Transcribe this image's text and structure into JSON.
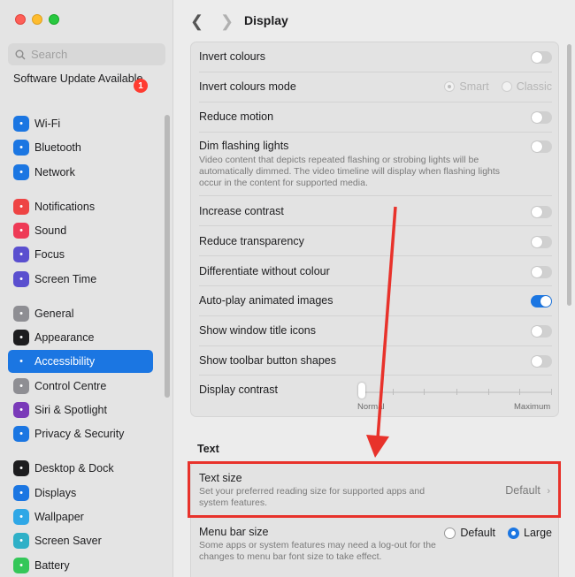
{
  "window": {
    "title": "Display"
  },
  "sidebar": {
    "search_placeholder": "Search",
    "update": {
      "label": "Software Update Available",
      "badge": "1"
    },
    "items": [
      {
        "label": "Wi-Fi",
        "color": "#1b76e2",
        "icon": "wifi-icon"
      },
      {
        "label": "Bluetooth",
        "color": "#1b76e2",
        "icon": "bluetooth-icon"
      },
      {
        "label": "Network",
        "color": "#1b76e2",
        "icon": "globe-icon"
      },
      {
        "label": "Notifications",
        "color": "#ee4444",
        "icon": "bell-icon"
      },
      {
        "label": "Sound",
        "color": "#ee3a56",
        "icon": "speaker-icon"
      },
      {
        "label": "Focus",
        "color": "#5a4fcf",
        "icon": "moon-icon"
      },
      {
        "label": "Screen Time",
        "color": "#5a4fcf",
        "icon": "hourglass-icon"
      },
      {
        "label": "General",
        "color": "#8e8e93",
        "icon": "gear-icon"
      },
      {
        "label": "Appearance",
        "color": "#1d1d1f",
        "icon": "appearance-icon"
      },
      {
        "label": "Accessibility",
        "color": "#1b76e2",
        "icon": "accessibility-icon",
        "selected": true
      },
      {
        "label": "Control Centre",
        "color": "#8e8e93",
        "icon": "control-centre-icon"
      },
      {
        "label": "Siri & Spotlight",
        "color": "#7a3ab9",
        "icon": "siri-icon"
      },
      {
        "label": "Privacy & Security",
        "color": "#1b76e2",
        "icon": "hand-icon"
      },
      {
        "label": "Desktop & Dock",
        "color": "#1d1d1f",
        "icon": "dock-icon"
      },
      {
        "label": "Displays",
        "color": "#1b76e2",
        "icon": "sun-icon"
      },
      {
        "label": "Wallpaper",
        "color": "#2fa7e6",
        "icon": "wallpaper-icon"
      },
      {
        "label": "Screen Saver",
        "color": "#2fb0c7",
        "icon": "screen-saver-icon"
      },
      {
        "label": "Battery",
        "color": "#34c759",
        "icon": "battery-icon"
      }
    ]
  },
  "display": {
    "invert_colours": {
      "label": "Invert colours",
      "on": false
    },
    "invert_mode": {
      "label": "Invert colours mode",
      "option1": "Smart",
      "option2": "Classic",
      "selected": "Smart"
    },
    "reduce_motion": {
      "label": "Reduce motion",
      "on": false
    },
    "dim_flashing": {
      "label": "Dim flashing lights",
      "desc": "Video content that depicts repeated flashing or strobing lights will be automatically dimmed. The video timeline will display when flashing lights occur in the content for supported media.",
      "on": false
    },
    "increase_contrast": {
      "label": "Increase contrast",
      "on": false
    },
    "reduce_transparency": {
      "label": "Reduce transparency",
      "on": false
    },
    "differentiate": {
      "label": "Differentiate without colour",
      "on": false
    },
    "autoplay": {
      "label": "Auto-play animated images",
      "on": true
    },
    "title_icons": {
      "label": "Show window title icons",
      "on": false
    },
    "toolbar_shapes": {
      "label": "Show toolbar button shapes",
      "on": false
    },
    "display_contrast": {
      "label": "Display contrast",
      "min_label": "Normal",
      "max_label": "Maximum",
      "level": 0
    }
  },
  "text_section": {
    "title": "Text",
    "text_size": {
      "label": "Text size",
      "desc": "Set your preferred reading size for supported apps and system features.",
      "value": "Default"
    },
    "menu_bar_size": {
      "label": "Menu bar size",
      "desc": "Some apps or system features may need a log-out for the changes to menu bar font size to take effect.",
      "option1": "Default",
      "option2": "Large",
      "selected": "Large"
    }
  },
  "annotation": {
    "color": "#e8322b"
  }
}
